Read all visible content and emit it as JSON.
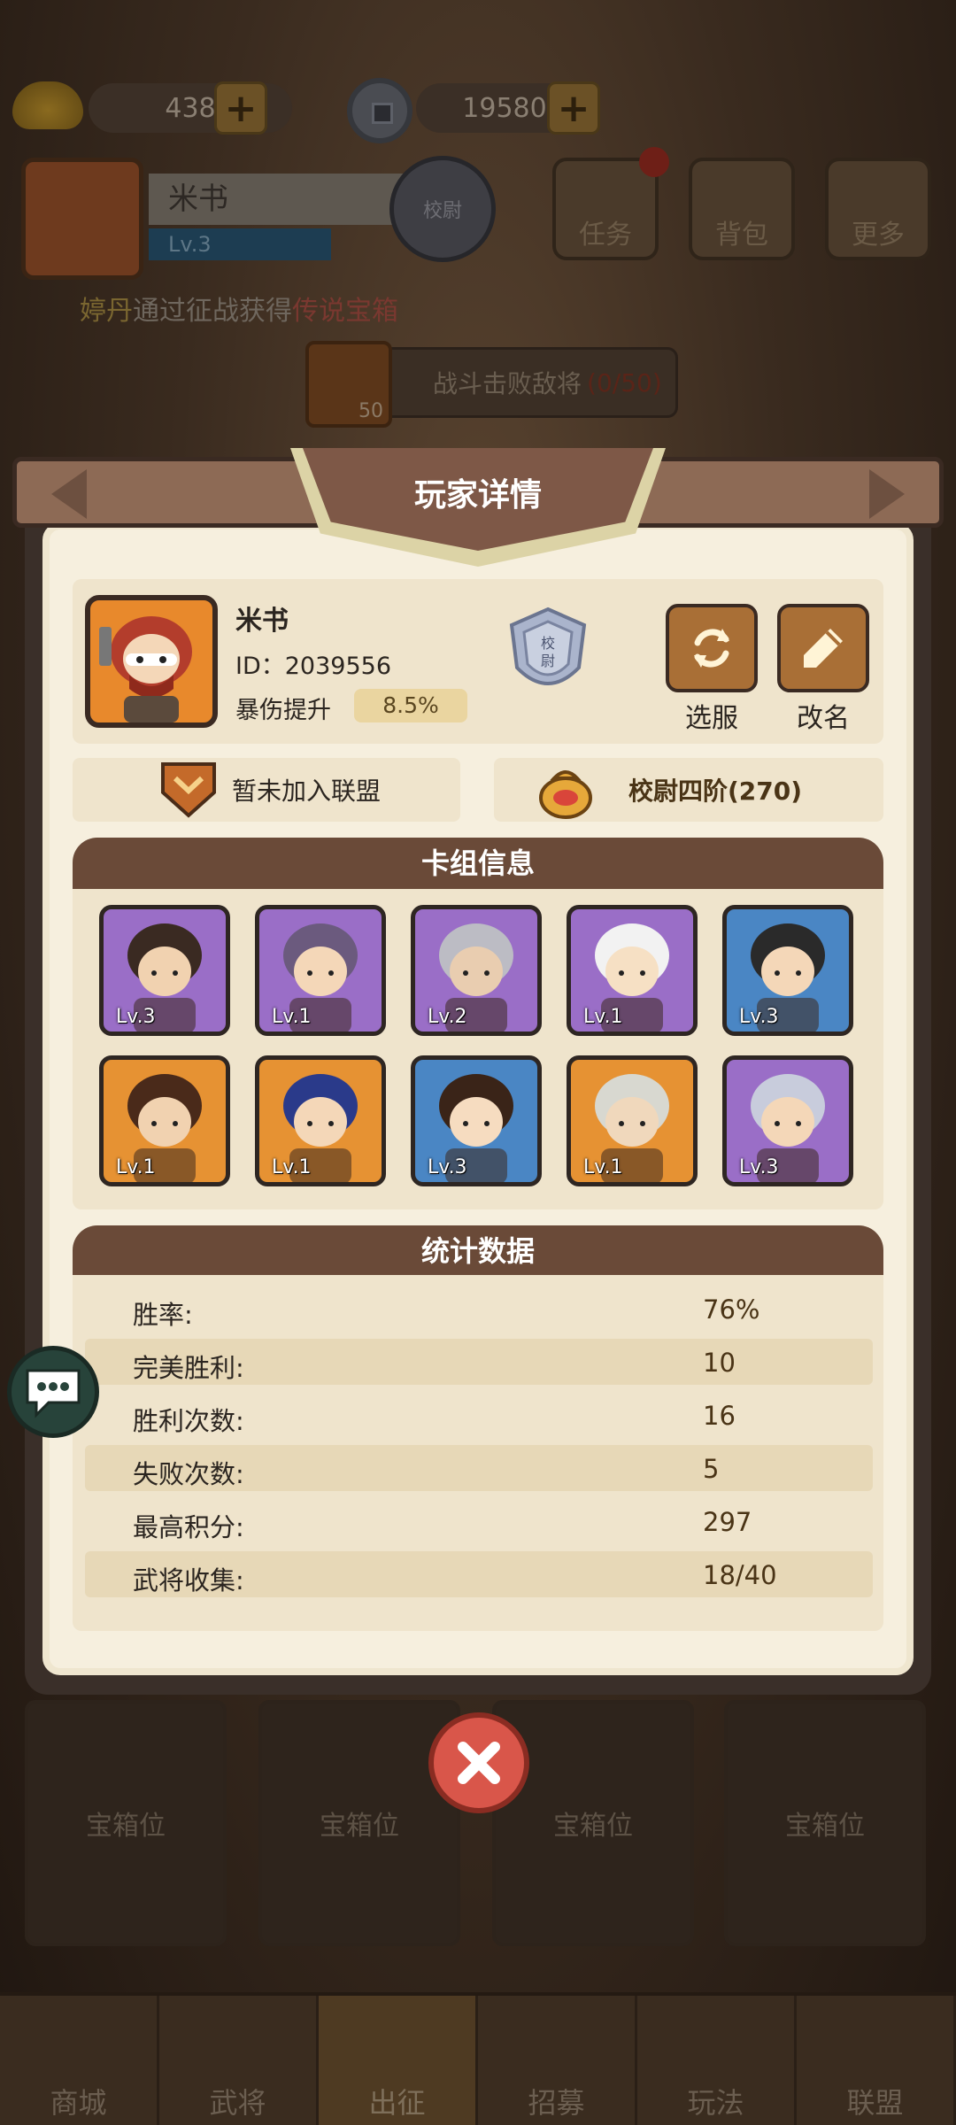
{
  "resources": {
    "ingots": "438",
    "coins": "19580"
  },
  "player_bar": {
    "name": "米书",
    "level": "Lv.3",
    "rank_badge": "校尉"
  },
  "top_menu": [
    {
      "label": "任务",
      "icon": "scroll-icon",
      "has_dot": true
    },
    {
      "label": "背包",
      "icon": "bag-icon",
      "has_dot": false
    },
    {
      "label": "更多",
      "icon": "menu-icon",
      "has_dot": false
    }
  ],
  "ticker": {
    "name": "婷丹",
    "text": "通过征战获得",
    "reward": "传说宝箱"
  },
  "task": {
    "reward_count": "50",
    "text": "战斗击败敌将",
    "progress": "(0/50)"
  },
  "dialog": {
    "title": "玩家详情",
    "profile": {
      "name": "米书",
      "id_label": "ID：2039556",
      "crit_label": "暴伤提升",
      "crit_value": "8.5%",
      "rank_badge": "校尉",
      "buttons": [
        {
          "label": "选服",
          "icon": "refresh-icon"
        },
        {
          "label": "改名",
          "icon": "pencil-icon"
        }
      ]
    },
    "alliance": "暂未加入联盟",
    "rank_title": "校尉四阶(270)",
    "deck_title": "卡组信息",
    "deck": [
      {
        "level": "Lv.3",
        "rarity": "purple"
      },
      {
        "level": "Lv.1",
        "rarity": "purple"
      },
      {
        "level": "Lv.2",
        "rarity": "purple"
      },
      {
        "level": "Lv.1",
        "rarity": "purple"
      },
      {
        "level": "Lv.3",
        "rarity": "blue"
      },
      {
        "level": "Lv.1",
        "rarity": "orange"
      },
      {
        "level": "Lv.1",
        "rarity": "orange"
      },
      {
        "level": "Lv.3",
        "rarity": "blue"
      },
      {
        "level": "Lv.1",
        "rarity": "orange"
      },
      {
        "level": "Lv.3",
        "rarity": "purple"
      }
    ],
    "stats_title": "统计数据",
    "stats": [
      {
        "label": "胜率:",
        "value": "76%"
      },
      {
        "label": "完美胜利:",
        "value": "10"
      },
      {
        "label": "胜利次数:",
        "value": "16"
      },
      {
        "label": "失败次数:",
        "value": "5"
      },
      {
        "label": "最高积分:",
        "value": "297"
      },
      {
        "label": "武将收集:",
        "value": "18/40"
      }
    ]
  },
  "chest_slots": [
    "宝箱位",
    "宝箱位",
    "宝箱位",
    "宝箱位"
  ],
  "bottom_nav": [
    {
      "label": "商城",
      "active": false
    },
    {
      "label": "武将",
      "active": false
    },
    {
      "label": "出征",
      "active": true
    },
    {
      "label": "招募",
      "active": false
    },
    {
      "label": "玩法",
      "active": false
    },
    {
      "label": "联盟",
      "active": false
    }
  ],
  "colors": {
    "accent_gold": "#e8b84a",
    "header_brown": "#6a4a38",
    "close_red": "#d9564a"
  }
}
